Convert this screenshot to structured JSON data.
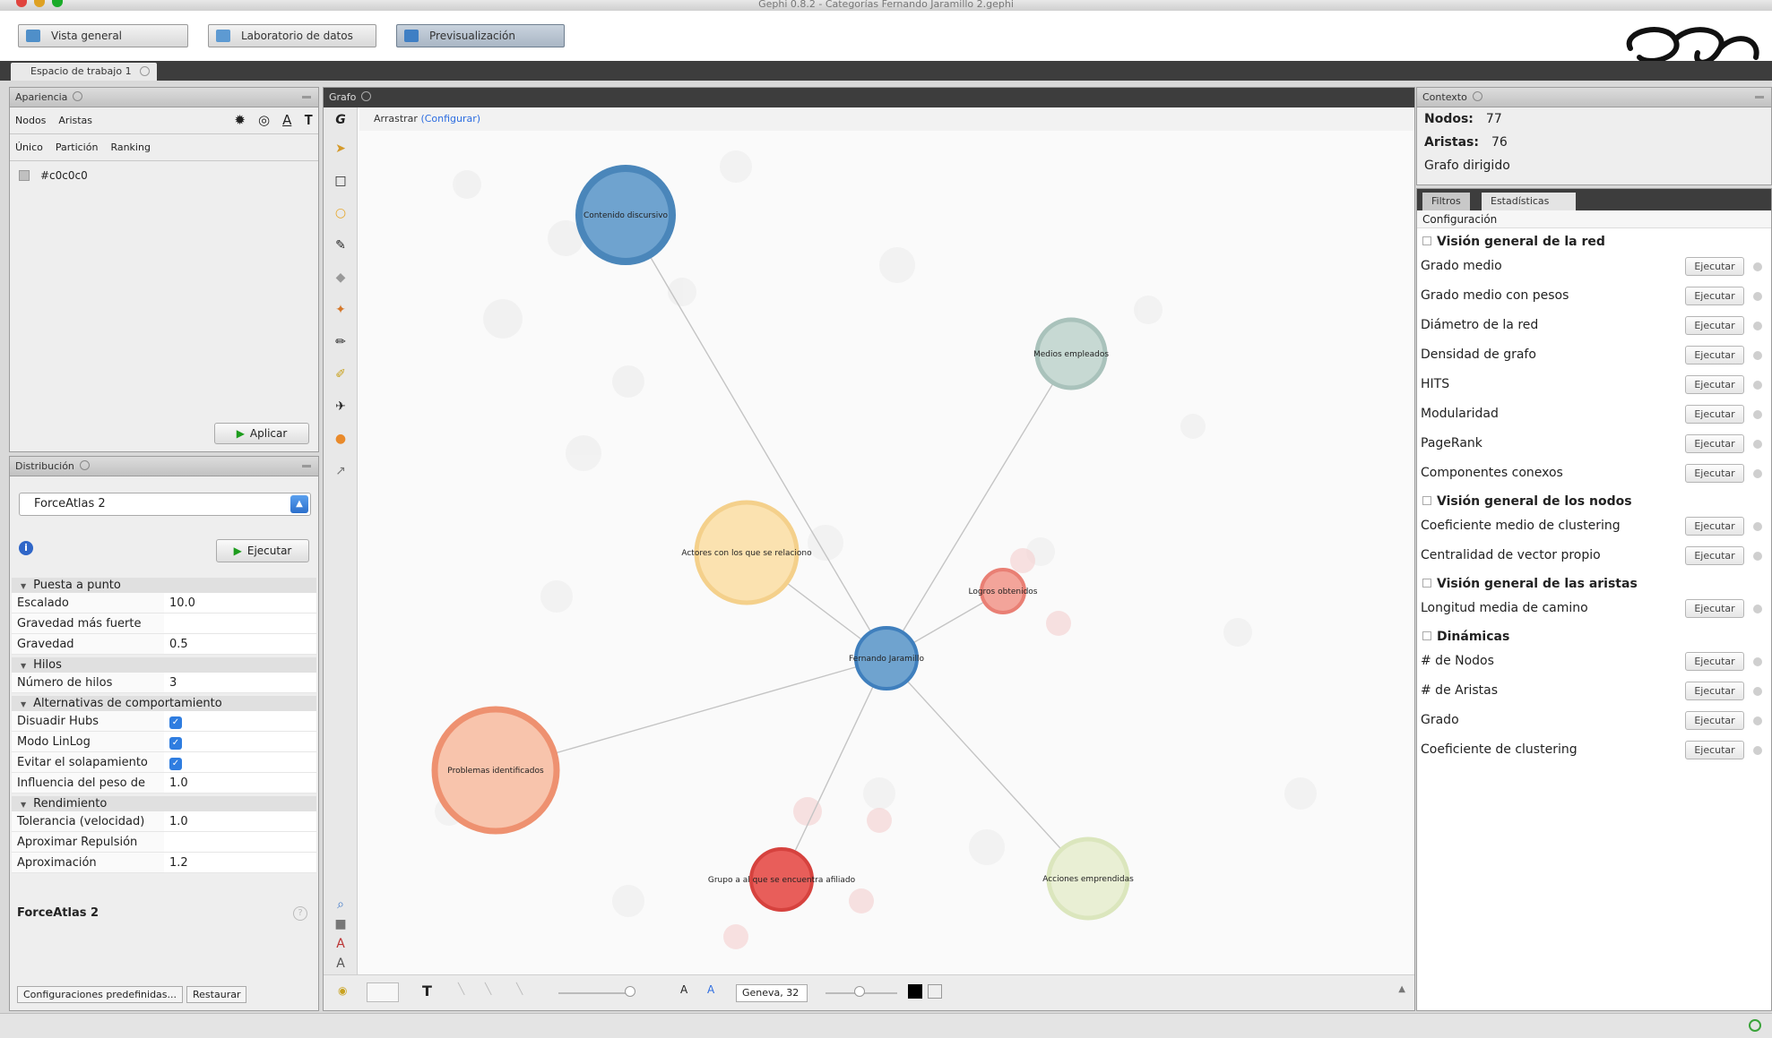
{
  "window": {
    "title": "Gephi 0.8.2 - Categorías Fernando Jaramillo 2.gephi"
  },
  "modes": [
    {
      "label": "Vista general",
      "icon": "overview-icon"
    },
    {
      "label": "Laboratorio de datos",
      "icon": "data-lab-icon"
    },
    {
      "label": "Previsualización",
      "icon": "preview-icon"
    }
  ],
  "workspace": {
    "tab_label": "Espacio de trabajo 1"
  },
  "appearance": {
    "title": "Apariencia",
    "element_tabs": [
      "Nodos",
      "Aristas"
    ],
    "mode_tabs": [
      "Único",
      "Partición",
      "Ranking"
    ],
    "color_value": "#c0c0c0",
    "apply_label": "Aplicar"
  },
  "layout": {
    "title": "Distribución",
    "selected_algorithm": "ForceAtlas 2",
    "run_label": "Ejecutar",
    "algorithm_name": "ForceAtlas 2",
    "presets_label": "Configuraciones predefinidas...",
    "reset_label": "Restaurar",
    "categories": [
      {
        "name": "Puesta a punto",
        "rows": [
          {
            "label": "Escalado",
            "value": "10.0"
          },
          {
            "label": "Gravedad más fuerte",
            "value": ""
          },
          {
            "label": "Gravedad",
            "value": "0.5"
          }
        ]
      },
      {
        "name": "Hilos",
        "rows": [
          {
            "label": "Número de hilos",
            "value": "3"
          }
        ]
      },
      {
        "name": "Alternativas de comportamiento",
        "rows": [
          {
            "label": "Disuadir Hubs",
            "checkbox": true
          },
          {
            "label": "Modo LinLog",
            "checkbox": true
          },
          {
            "label": "Evitar el solapamiento",
            "checkbox": true
          },
          {
            "label": "Influencia del peso de",
            "value": "1.0"
          }
        ]
      },
      {
        "name": "Rendimiento",
        "rows": [
          {
            "label": "Tolerancia (velocidad)",
            "value": "1.0"
          },
          {
            "label": "Aproximar Repulsión",
            "value": ""
          },
          {
            "label": "Aproximación",
            "value": "1.2"
          }
        ]
      }
    ]
  },
  "graph": {
    "title": "Grafo",
    "drag_label": "Arrastrar",
    "configure_label": "(Configurar)",
    "font_value": "Geneva, 32",
    "nodes": [
      {
        "label": "Contenido discursivo",
        "color": "#6fa3cf",
        "ring": "#4a86ba",
        "size": "big"
      },
      {
        "label": "Medios empleados",
        "color": "#c7d9d3",
        "ring": "#a9c2bb",
        "size": "medium"
      },
      {
        "label": "Actores con los que se relaciono",
        "color": "#fbe2b0",
        "ring": "#f4d08b",
        "size": "large"
      },
      {
        "label": "Logros obtenidos",
        "color": "#f3a49a",
        "ring": "#e97f74",
        "size": "small"
      },
      {
        "label": "Fernando Jaramillo",
        "color": "#6fa3cf",
        "ring": "#3f7fbd",
        "size": "hub"
      },
      {
        "label": "Problemas identificados",
        "color": "#f8c4ac",
        "ring": "#ee9170",
        "size": "big"
      },
      {
        "label": "Acciones emprendidas",
        "color": "#e9efd4",
        "ring": "#dbe6bd",
        "size": "medium"
      },
      {
        "label": "Grupo a al que se encuentra afiliado",
        "color": "#e85e5a",
        "ring": "#d6423e",
        "size": "medium"
      }
    ]
  },
  "context": {
    "title": "Contexto",
    "nodes_label": "Nodos:",
    "nodes_value": "77",
    "edges_label": "Aristas:",
    "edges_value": "76",
    "graph_type": "Grafo dirigido"
  },
  "stats": {
    "tab_filters": "Filtros",
    "tab_stats": "Estadísticas",
    "config_label": "Configuración",
    "run_label": "Ejecutar",
    "sections": [
      {
        "name": "Visión general de la red",
        "items": [
          "Grado medio",
          "Grado medio con pesos",
          "Diámetro de la red",
          "Densidad de grafo",
          "HITS",
          "Modularidad",
          "PageRank",
          "Componentes conexos"
        ]
      },
      {
        "name": "Visión general de los nodos",
        "items": [
          "Coeficiente medio de clustering",
          "Centralidad de vector propio"
        ]
      },
      {
        "name": "Visión general de las aristas",
        "items": [
          "Longitud media de camino"
        ]
      },
      {
        "name": "Dinámicas",
        "items": [
          "# de Nodos",
          "# de Aristas",
          "Grado",
          "Coeficiente de clustering"
        ]
      }
    ]
  }
}
